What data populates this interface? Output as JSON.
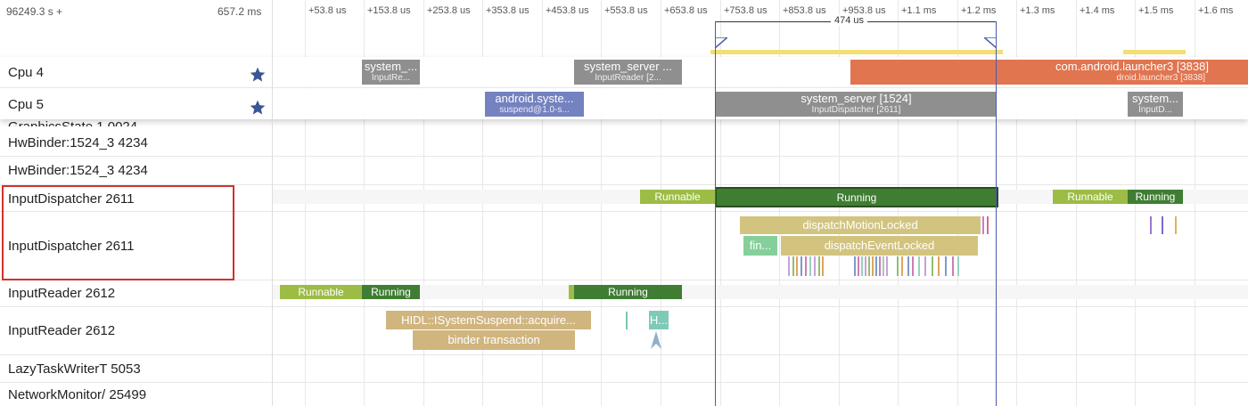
{
  "header": {
    "time_offset": "96249.3 s +",
    "window_duration": "657.2 ms",
    "ticks": [
      "+53.8 us",
      "+153.8 us",
      "+253.8 us",
      "+353.8 us",
      "+453.8 us",
      "+553.8 us",
      "+653.8 us",
      "+753.8 us",
      "+853.8 us",
      "+953.8 us",
      "+1.1 ms",
      "+1.2 ms",
      "+1.3 ms",
      "+1.4 ms",
      "+1.5 ms",
      "+1.6 ms"
    ],
    "selection_duration": "474 us"
  },
  "pinned_tracks": [
    {
      "label": "Cpu 4",
      "starred": true
    },
    {
      "label": "Cpu 5",
      "starred": true
    }
  ],
  "cpu4_slices": [
    {
      "title": "system_...",
      "subtitle": "InputRe..."
    },
    {
      "title": "system_server ...",
      "subtitle": "InputReader [2..."
    },
    {
      "title": "com.android.launcher3 [3838]",
      "subtitle": "droid.launcher3 [3838]"
    }
  ],
  "cpu5_slices": [
    {
      "title": "android.syste...",
      "subtitle": "suspend@1.0-s..."
    },
    {
      "title": "system_server [1524]",
      "subtitle": "InputDispatcher [2611]"
    },
    {
      "title": "system...",
      "subtitle": "InputD..."
    }
  ],
  "partial_label": "GraphicsState 1 0024",
  "tracks": [
    {
      "label": "HwBinder:1524_3 4234"
    },
    {
      "label": "HwBinder:1524_3 4234"
    },
    {
      "label": "InputDispatcher 2611"
    },
    {
      "label": "InputDispatcher 2611"
    },
    {
      "label": "InputReader 2612"
    },
    {
      "label": "InputReader 2612"
    },
    {
      "label": "LazyTaskWriterT 5053"
    },
    {
      "label": "NetworkMonitor/ 25499"
    }
  ],
  "input_dispatcher_states": [
    "Runnable",
    "Running",
    "Runnable",
    "Running"
  ],
  "input_dispatcher_slices": [
    "dispatchMotionLocked",
    "fin...",
    "dispatchEventLocked"
  ],
  "input_reader_states": [
    "Runnable",
    "Running",
    "Running"
  ],
  "input_reader_slices": [
    "HIDL::ISystemSuspend::acquire...",
    "binder transaction",
    "H..."
  ],
  "colors": {
    "runnable": "#9cbc45",
    "running": "#3f7d33",
    "cpu_gray": "#8f8f8f",
    "launcher": "#e07550",
    "suspend": "#7482c0",
    "slice_khaki": "#d2c47f",
    "slice_tan": "#d0b57f",
    "selection": "#4a5aa8",
    "highlight_box": "#d0312d"
  }
}
